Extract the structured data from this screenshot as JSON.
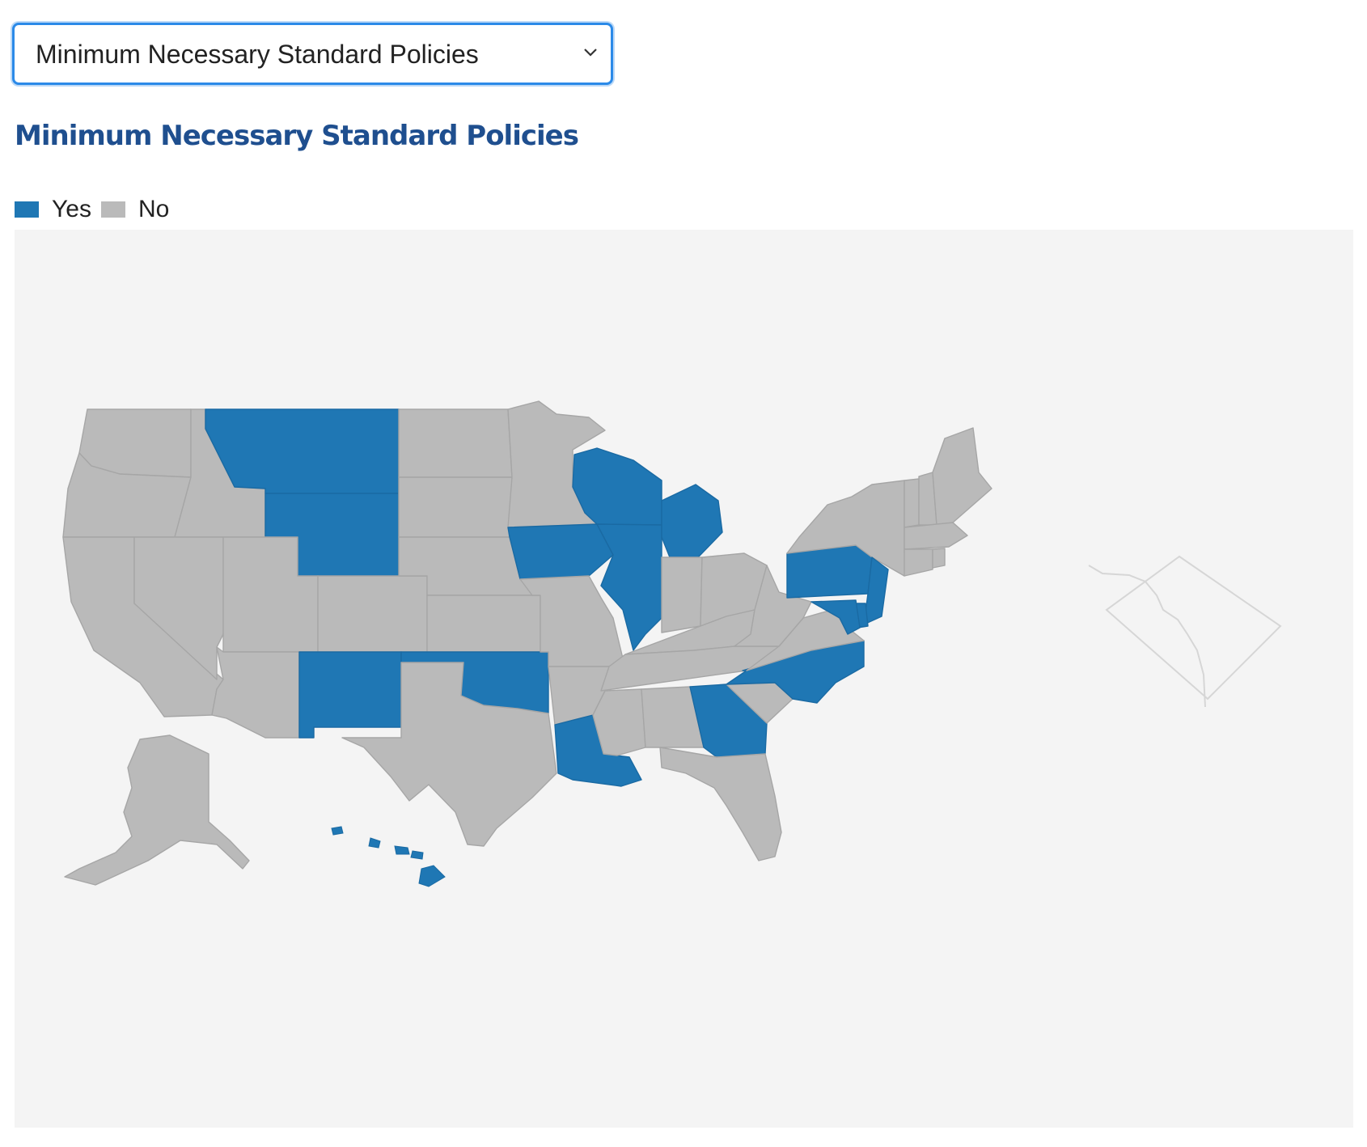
{
  "policy_select": {
    "selected": "Minimum Necessary Standard Policies",
    "options": [
      "Minimum Necessary Standard Policies"
    ]
  },
  "map_title": "Minimum Necessary Standard Policies",
  "legend": [
    {
      "label": "Yes",
      "color": "#1f77b4"
    },
    {
      "label": "No",
      "color": "#bababa"
    }
  ],
  "colors": {
    "yes": "#1f77b4",
    "no": "#bababa",
    "background": "#f4f4f4",
    "dc_outline": "#d6d6d6",
    "title": "#1f4f8f",
    "select_border": "#2b8ae8"
  },
  "map_data": {
    "type": "choropleth",
    "region": "United States",
    "yes_states": [
      "MT",
      "WY",
      "NM",
      "OK",
      "IA",
      "WI",
      "IL",
      "MI",
      "LA",
      "GA",
      "NC",
      "PA",
      "NJ",
      "MD",
      "DE",
      "HI"
    ],
    "no_states": [
      "WA",
      "OR",
      "ID",
      "CA",
      "NV",
      "UT",
      "AZ",
      "CO",
      "ND",
      "SD",
      "NE",
      "KS",
      "TX",
      "MN",
      "MO",
      "AR",
      "MS",
      "AL",
      "TN",
      "KY",
      "IN",
      "OH",
      "WV",
      "VA",
      "SC",
      "FL",
      "NY",
      "VT",
      "NH",
      "ME",
      "MA",
      "CT",
      "RI",
      "AK",
      "DC"
    ]
  }
}
